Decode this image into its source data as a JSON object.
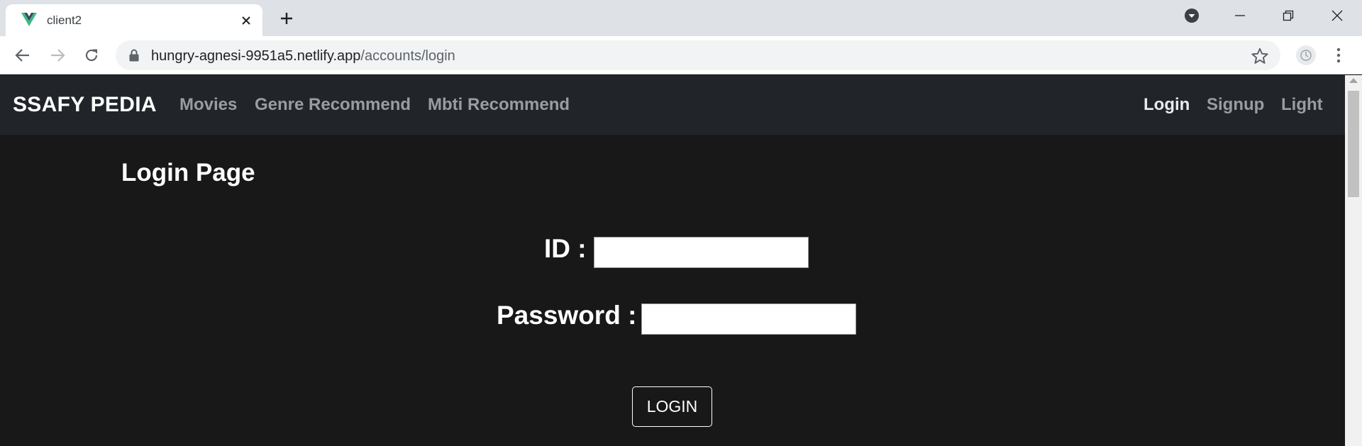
{
  "browser": {
    "tab_title": "client2",
    "url_host": "hungry-agnesi-9951a5.netlify.app",
    "url_path": "/accounts/login"
  },
  "navbar": {
    "brand": "SSAFY PEDIA",
    "links": [
      "Movies",
      "Genre Recommend",
      "Mbti Recommend"
    ],
    "right_links": [
      "Login",
      "Signup",
      "Light"
    ]
  },
  "page": {
    "title": "Login Page",
    "id_label": "ID :",
    "id_value": "",
    "password_label": "Password :",
    "password_value": "",
    "submit_label": "LOGIN"
  },
  "colors": {
    "navbar_bg": "#212529",
    "page_bg": "#181818",
    "vue_green": "#41b883",
    "vue_dark": "#35495e"
  },
  "icons": {
    "favicon": "vue-logo-icon",
    "tab_close": "close-icon",
    "new_tab": "plus-icon",
    "back": "arrow-left-icon",
    "forward": "arrow-right-icon",
    "reload": "reload-icon",
    "lock": "lock-icon",
    "bookmark": "star-icon",
    "profile": "profile-icon",
    "menu": "kebab-menu-icon"
  }
}
